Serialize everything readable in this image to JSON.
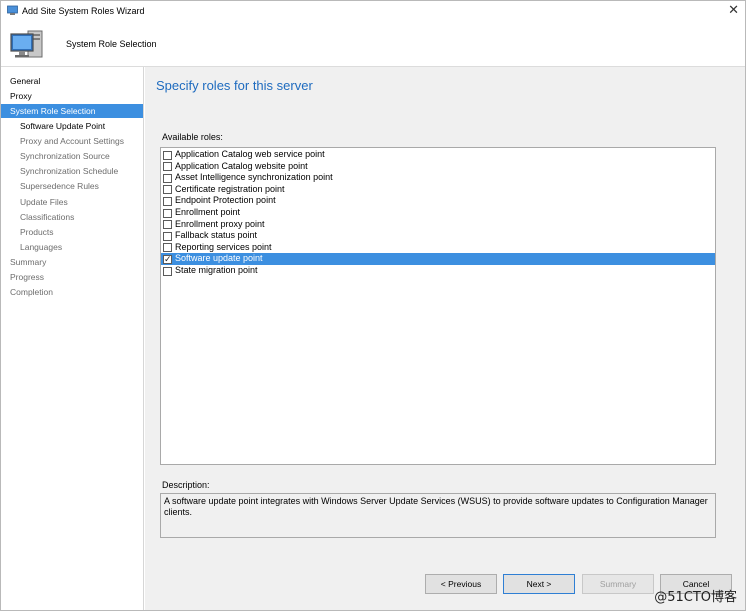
{
  "window": {
    "title": "Add Site System Roles Wizard",
    "close_glyph": "✕"
  },
  "header": {
    "step_title": "System Role Selection"
  },
  "nav": {
    "items": [
      {
        "label": "General"
      },
      {
        "label": "Proxy"
      },
      {
        "label": "System Role Selection"
      },
      {
        "label": "Software Update Point"
      },
      {
        "label": "Proxy and Account Settings"
      },
      {
        "label": "Synchronization Source"
      },
      {
        "label": "Synchronization Schedule"
      },
      {
        "label": "Supersedence Rules"
      },
      {
        "label": "Update Files"
      },
      {
        "label": "Classifications"
      },
      {
        "label": "Products"
      },
      {
        "label": "Languages"
      },
      {
        "label": "Summary"
      },
      {
        "label": "Progress"
      },
      {
        "label": "Completion"
      }
    ]
  },
  "main": {
    "heading": "Specify roles for this server",
    "available_roles_label": "Available roles:",
    "roles": [
      {
        "label": "Application Catalog web service point",
        "checked": false
      },
      {
        "label": "Application Catalog website point",
        "checked": false
      },
      {
        "label": "Asset Intelligence synchronization point",
        "checked": false
      },
      {
        "label": "Certificate registration point",
        "checked": false
      },
      {
        "label": "Endpoint Protection point",
        "checked": false
      },
      {
        "label": "Enrollment point",
        "checked": false
      },
      {
        "label": "Enrollment proxy point",
        "checked": false
      },
      {
        "label": "Fallback status point",
        "checked": false
      },
      {
        "label": "Reporting services point",
        "checked": false
      },
      {
        "label": "Software update point",
        "checked": true
      },
      {
        "label": "State migration point",
        "checked": false
      }
    ],
    "description_label": "Description:",
    "description_text": "A software update point integrates with Windows Server Update Services (WSUS) to provide software updates to Configuration Manager clients."
  },
  "footer": {
    "previous_label": "< Previous",
    "next_label": "Next >",
    "summary_label": "Summary",
    "cancel_label": "Cancel"
  },
  "watermark": "@51CTO博客",
  "colors": {
    "accent": "#3c8fe0",
    "heading": "#1e6bbf"
  }
}
